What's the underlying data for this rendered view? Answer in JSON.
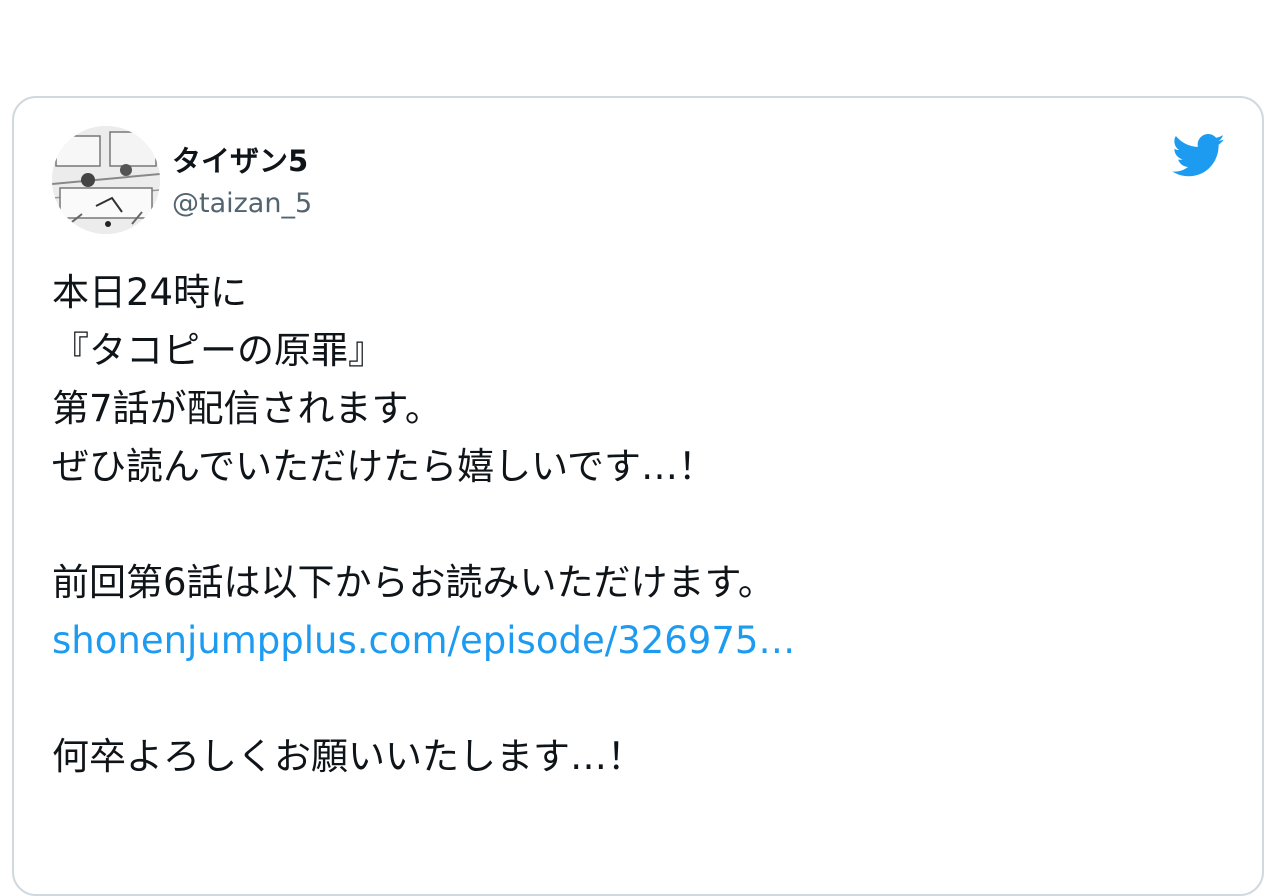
{
  "tweet": {
    "author": {
      "display_name": "タイザン5",
      "handle": "@taizan_5"
    },
    "icon": "twitter-bird-icon",
    "accent_color": "#1d9bf0",
    "lines": [
      "本日24時に",
      "『タコピーの原罪』",
      "第7話が配信されます。",
      "ぜひ読んでいただけたら嬉しいです…！",
      "前回第6話は以下からお読みいただけます。",
      "何卒よろしくお願いいたします…！"
    ],
    "link_text": "shonenjumpplus.com/episode/326975…"
  }
}
